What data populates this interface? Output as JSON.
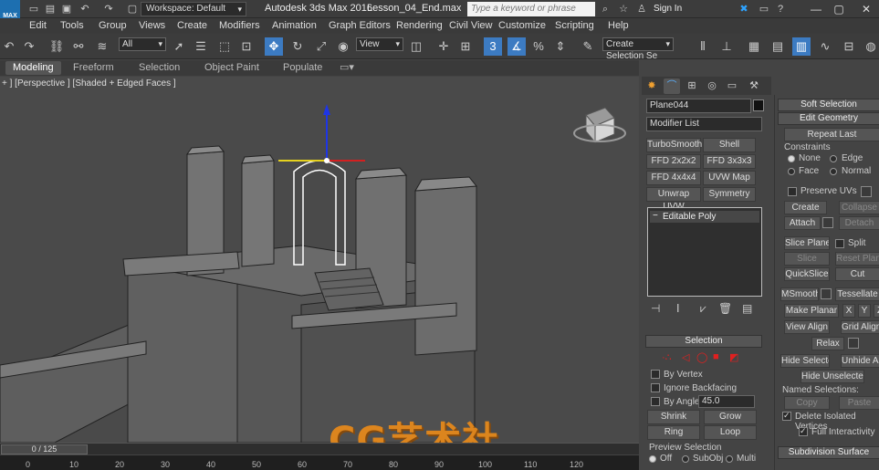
{
  "titlebar": {
    "workspace": "Workspace: Default",
    "app_title": "Autodesk 3ds Max 2016",
    "file_name": "Lesson_04_End.max",
    "search_placeholder": "Type a keyword or phrase",
    "sign_in": "Sign In",
    "logo_text": "MAX"
  },
  "menus": [
    "Edit",
    "Tools",
    "Group",
    "Views",
    "Create",
    "Modifiers",
    "Animation",
    "Graph Editors",
    "Rendering",
    "Civil View",
    "Customize",
    "Scripting",
    "Help"
  ],
  "toolbar": {
    "filter": "All",
    "coord": "View",
    "selection_set": "Create Selection Se"
  },
  "ribbon": {
    "tabs": [
      "Modeling",
      "Freeform",
      "Selection",
      "Object Paint",
      "Populate"
    ]
  },
  "viewport": {
    "label": "+ ] [Perspective ] [Shaded + Edged Faces ]"
  },
  "timeline": {
    "frame": "0 / 125",
    "ticks": [
      "0",
      "10",
      "20",
      "30",
      "40",
      "50",
      "60",
      "70",
      "80",
      "90",
      "100",
      "110",
      "120"
    ]
  },
  "command_panel": {
    "object_name": "Plane044",
    "modifier_list": "Modifier List",
    "mod_buttons": [
      "TurboSmooth",
      "Shell",
      "FFD 2x2x2",
      "FFD 3x3x3",
      "FFD 4x4x4",
      "UVW Map",
      "Unwrap UVW",
      "Symmetry"
    ],
    "stack_item": "Editable Poly",
    "selection": {
      "title": "Selection",
      "by_vertex": "By Vertex",
      "ignore_backfacing": "Ignore Backfacing",
      "by_angle": "By Angle:",
      "angle_value": "45.0",
      "shrink": "Shrink",
      "grow": "Grow",
      "ring": "Ring",
      "loop": "Loop",
      "preview_title": "Preview Selection",
      "off": "Off",
      "subobj": "SubObj",
      "multi": "Multi"
    }
  },
  "edit_geometry": {
    "soft_selection": "Soft Selection",
    "title": "Edit Geometry",
    "repeat_last": "Repeat Last",
    "constraints": "Constraints",
    "none": "None",
    "edge": "Edge",
    "face": "Face",
    "normal": "Normal",
    "preserve_uvs": "Preserve UVs",
    "create": "Create",
    "collapse": "Collapse",
    "attach": "Attach",
    "detach": "Detach",
    "slice_plane": "Slice Plane",
    "split": "Split",
    "slice": "Slice",
    "reset_plane": "Reset Plane",
    "quickslice": "QuickSlice",
    "cut": "Cut",
    "msmooth": "MSmooth",
    "tessellate": "Tessellate",
    "make_planar": "Make Planar",
    "x": "X",
    "y": "Y",
    "z": "Z",
    "view_align": "View Align",
    "grid_align": "Grid Align",
    "relax": "Relax",
    "hide_selected": "Hide Selected",
    "unhide_all": "Unhide All",
    "hide_unselected": "Hide Unselected",
    "named_selections": "Named Selections:",
    "copy": "Copy",
    "paste": "Paste",
    "delete_isolated": "Delete Isolated Vertices",
    "full_interactivity": "Full Interactivity",
    "subdivision_surface": "Subdivision Surface"
  },
  "watermark": "CG艺术社"
}
